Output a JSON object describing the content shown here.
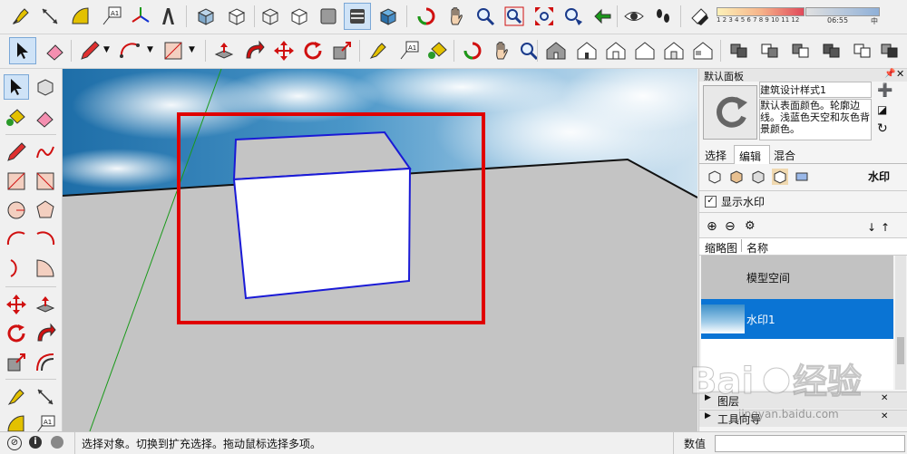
{
  "toolbar": {
    "view_labels": {
      "label_icon": "A1",
      "color_scale_ticks": "1 2 3 4 5 6 7 8 9 10 11 12",
      "time_value": "06:55",
      "time_right": "中"
    },
    "icons_row1": [
      "tape-measure-icon",
      "dimension-icon",
      "protractor-icon",
      "text-label-icon",
      "axes-icon",
      "3d-text-icon",
      "iso-view-icon",
      "top-view-icon",
      "front-view-icon",
      "right-view-icon",
      "back-view-icon",
      "left-view-icon",
      "orbit-icon",
      "pan-icon",
      "zoom-icon",
      "zoom-window-icon",
      "zoom-extents-icon",
      "position-camera-icon",
      "look-around-icon",
      "walk-icon",
      "shadow-icon"
    ],
    "icons_row2": [
      "select-icon",
      "eraser-icon",
      "pencil-icon",
      "arc-icon",
      "rectangle-icon",
      "push-pull-icon",
      "follow-me-icon",
      "move-icon",
      "rotate-icon",
      "scale-icon",
      "tape-measure-icon",
      "text-icon",
      "paint-bucket-icon",
      "orbit-icon",
      "house-icons",
      "component-icons"
    ]
  },
  "left_tools": {
    "text_label": "A1"
  },
  "panel": {
    "title": "默认面板",
    "style_name": "建筑设计样式1",
    "style_desc": "默认表面颜色。轮廓边线。浅蓝色天空和灰色背景颜色。",
    "tabs": [
      "选择",
      "编辑",
      "混合"
    ],
    "active_tab": "编辑",
    "edit_section_label": "水印",
    "show_watermark_label": "显示水印",
    "show_watermark_checked": true,
    "col_thumb": "缩略图",
    "col_name": "名称",
    "list": [
      {
        "name": "模型空间"
      },
      {
        "name": "水印1"
      }
    ],
    "collapsed": [
      "图层",
      "工具向导"
    ]
  },
  "status": {
    "message": "选择对象。切换到扩充选择。拖动鼠标选择多项。",
    "value_label": "数值",
    "value_text": ""
  },
  "watermark": {
    "site": "jingyan.baidu.com"
  },
  "colors": {
    "ground": "#c4c4c4",
    "highlight_box": "#e00000",
    "box_edge": "#1a1ad6",
    "selected_row": "#0a74d4"
  }
}
